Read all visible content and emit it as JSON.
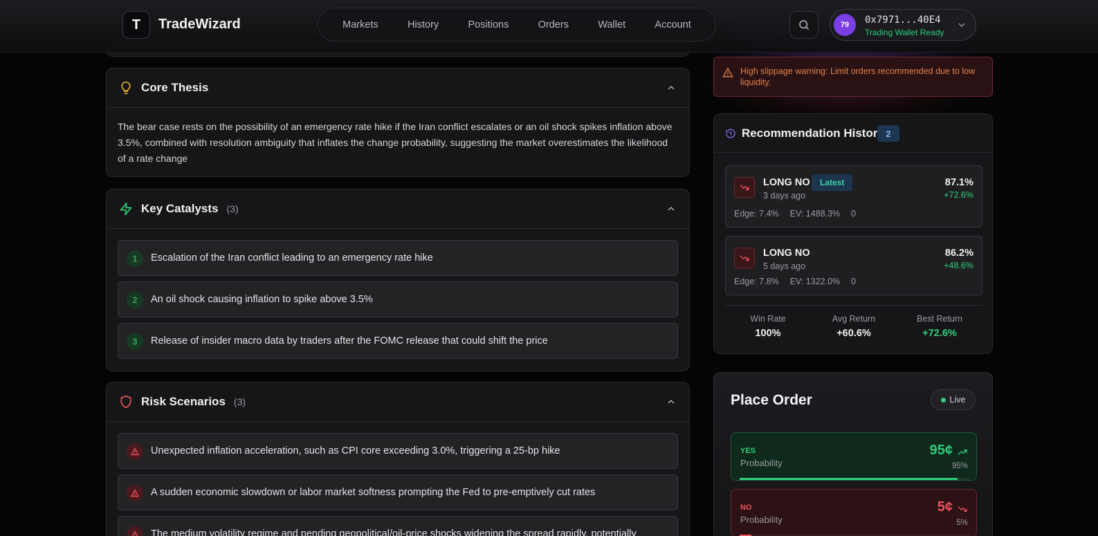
{
  "header": {
    "logo_letter": "T",
    "brand": "TradeWizard",
    "nav": [
      "Markets",
      "History",
      "Positions",
      "Orders",
      "Wallet",
      "Account"
    ],
    "wallet": {
      "avatar_text": "79",
      "address": "0x7971...40E4",
      "status": "Trading Wallet Ready"
    }
  },
  "core_thesis": {
    "title": "Core Thesis",
    "text": "The bear case rests on the possibility of an emergency rate hike if the Iran conflict escalates or an oil shock spikes inflation above 3.5%, combined with resolution ambiguity that inflates the change probability, suggesting the market overestimates the likelihood of a rate change"
  },
  "key_catalysts": {
    "title": "Key Catalysts",
    "count": "(3)",
    "items": [
      {
        "num": "1",
        "text": "Escalation of the Iran conflict leading to an emergency rate hike"
      },
      {
        "num": "2",
        "text": "An oil shock causing inflation to spike above 3.5%"
      },
      {
        "num": "3",
        "text": "Release of insider macro data by traders after the FOMC release that could shift the price"
      }
    ]
  },
  "risk_scenarios": {
    "title": "Risk Scenarios",
    "count": "(3)",
    "items": [
      {
        "text": "Unexpected inflation acceleration, such as CPI core exceeding 3.0%, triggering a 25-bp hike"
      },
      {
        "text": "A sudden economic slowdown or labor market softness prompting the Fed to pre-emptively cut rates"
      },
      {
        "text": "The medium volatility regime and pending geopolitical/oil-price shocks widening the spread rapidly, potentially"
      }
    ]
  },
  "alert": {
    "text": "High slippage warning: Limit orders recommended due to low liquidity."
  },
  "recommendation_history": {
    "title": "Recommendation History",
    "count": "2",
    "items": [
      {
        "position": "LONG NO",
        "badge": "Latest",
        "time": "3 days ago",
        "pct": "87.1%",
        "ret": "+72.6%",
        "edge": "Edge: 7.4%",
        "ev": "EV: 1488.3%",
        "extra": "0"
      },
      {
        "position": "LONG NO",
        "badge": "",
        "time": "5 days ago",
        "pct": "86.2%",
        "ret": "+48.6%",
        "edge": "Edge: 7.8%",
        "ev": "EV: 1322.0%",
        "extra": "0"
      }
    ],
    "stats": [
      {
        "label": "Win Rate",
        "value": "100%"
      },
      {
        "label": "Avg Return",
        "value": "+60.6%"
      },
      {
        "label": "Best Return",
        "value": "+72.6%"
      }
    ]
  },
  "place_order": {
    "title": "Place Order",
    "live_label": "Live",
    "yes": {
      "side": "YES",
      "label": "Probability",
      "price": "95¢",
      "pct": "95%",
      "fill": 0.95
    },
    "no": {
      "side": "NO",
      "label": "Probability",
      "price": "5¢",
      "pct": "5%",
      "fill": 0.05
    }
  },
  "colors": {
    "accent_green": "#2ecf7a",
    "accent_red": "#f0525c",
    "warning_orange": "#e0824a",
    "avatar_purple": "#7b3fe4"
  }
}
